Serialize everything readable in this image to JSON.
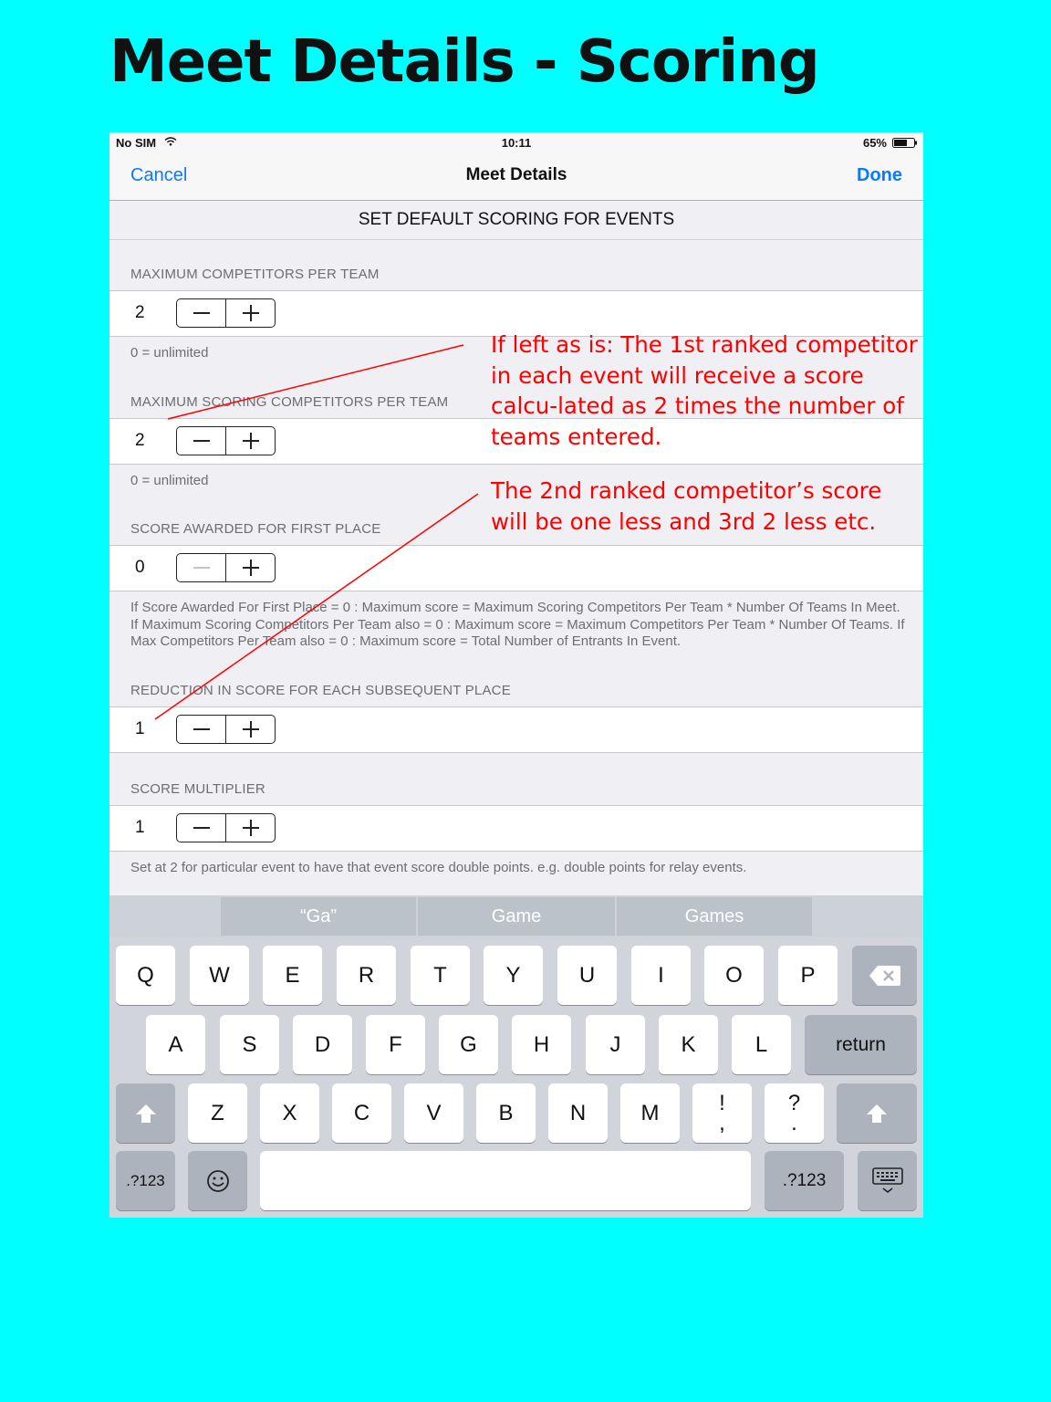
{
  "page_heading": "Meet Details - Scoring",
  "status_bar": {
    "carrier": "No SIM",
    "time": "10:11",
    "battery": "65%"
  },
  "nav": {
    "cancel": "Cancel",
    "title": "Meet Details",
    "done": "Done"
  },
  "subheader": "SET DEFAULT SCORING FOR EVENTS",
  "sections": [
    {
      "header": "MAXIMUM COMPETITORS PER TEAM",
      "value": "2",
      "minus_enabled": true,
      "footer": "0 = unlimited"
    },
    {
      "header": "MAXIMUM SCORING COMPETITORS PER TEAM",
      "value": "2",
      "minus_enabled": true,
      "footer": "0 = unlimited"
    },
    {
      "header": "SCORE AWARDED FOR FIRST PLACE",
      "value": "0",
      "minus_enabled": false,
      "footer": "If Score Awarded For First Place = 0 : Maximum score = Maximum Scoring Competitors Per Team * Number Of Teams In Meet. If Maximum Scoring Competitors Per Team also = 0 : Maximum score = Maximum Competitors Per Team * Number Of Teams.  If Max Competitors Per Team also = 0 : Maximum score = Total Number of Entrants In Event."
    },
    {
      "header": "REDUCTION IN SCORE FOR EACH SUBSEQUENT PLACE",
      "value": "1",
      "minus_enabled": true,
      "footer": ""
    },
    {
      "header": "SCORE MULTIPLIER",
      "value": "1",
      "minus_enabled": true,
      "footer": "Set at 2 for particular event to have that event score double points. e.g. double points for relay events."
    }
  ],
  "annotations": [
    "If left as is: The 1st ranked competitor in each event will receive a score calcu-lated as 2 times the number of teams entered.",
    "The 2nd ranked competitor’s score will be one less and 3rd 2 less etc."
  ],
  "annotation_color": "#ff0000",
  "accent_color": "#0a7aff",
  "keyboard": {
    "suggestions": [
      "“Ga”",
      "Game",
      "Games"
    ],
    "row1": [
      "Q",
      "W",
      "E",
      "R",
      "T",
      "Y",
      "U",
      "I",
      "O",
      "P"
    ],
    "row2": [
      "A",
      "S",
      "D",
      "F",
      "G",
      "H",
      "J",
      "K",
      "L"
    ],
    "row3": [
      "Z",
      "X",
      "C",
      "V",
      "B",
      "N",
      "M"
    ],
    "punct1": [
      "!",
      ","
    ],
    "punct2": [
      "?",
      "."
    ],
    "return_label": "return",
    "numbers_label": ".?123",
    "icons": [
      "delete-icon",
      "shift-icon",
      "emoji-icon",
      "hide-keyboard-icon"
    ]
  }
}
